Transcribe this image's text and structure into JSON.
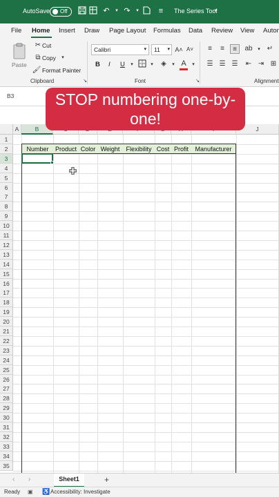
{
  "titlebar": {
    "autosave_label": "AutoSave",
    "autosave_state": "Off",
    "file_title": "The Series Tool",
    "bg_color": "#1e7145"
  },
  "menu": {
    "tabs": [
      "File",
      "Home",
      "Insert",
      "Draw",
      "Page Layout",
      "Formulas",
      "Data",
      "Review",
      "View",
      "Autom"
    ],
    "active": "Home"
  },
  "ribbon": {
    "clipboard": {
      "paste_label": "Paste",
      "cut_label": "Cut",
      "copy_label": "Copy",
      "format_painter_label": "Format Painter",
      "group_label": "Clipboard"
    },
    "font": {
      "font_name": "Calibri",
      "font_size": "11",
      "bold": "B",
      "italic": "I",
      "underline": "U",
      "group_label": "Font",
      "font_color": "#e0242c"
    },
    "alignment": {
      "group_label": "Alignment"
    }
  },
  "formula_bar": {
    "name_box": "B3"
  },
  "overlay": {
    "line1": "STOP numbering one-by-",
    "line2": "one!",
    "bg_color": "#d42d43"
  },
  "grid": {
    "columns": [
      "A",
      "B",
      "C",
      "D",
      "E",
      "F",
      "G",
      "H",
      "I",
      "J"
    ],
    "selected_column": "B",
    "rows": [
      "1",
      "2",
      "3",
      "4",
      "5",
      "6",
      "7",
      "8",
      "9",
      "10",
      "11",
      "12",
      "13",
      "14",
      "15",
      "16",
      "17",
      "18",
      "19",
      "20",
      "21",
      "22",
      "23",
      "24",
      "25",
      "26",
      "27",
      "28",
      "29",
      "30",
      "31",
      "32",
      "33",
      "34",
      "35"
    ],
    "selected_row": "3",
    "table_headers": [
      "Number",
      "Product",
      "Color",
      "Weight",
      "Flexibility",
      "Cost",
      "Profit",
      "Manufacturer"
    ],
    "header_fill": "#e2f0d9"
  },
  "sheets": {
    "tabs": [
      "Sheet1"
    ],
    "add_label": "+"
  },
  "status": {
    "ready": "Ready",
    "accessibility": "Accessibility: Investigate"
  }
}
